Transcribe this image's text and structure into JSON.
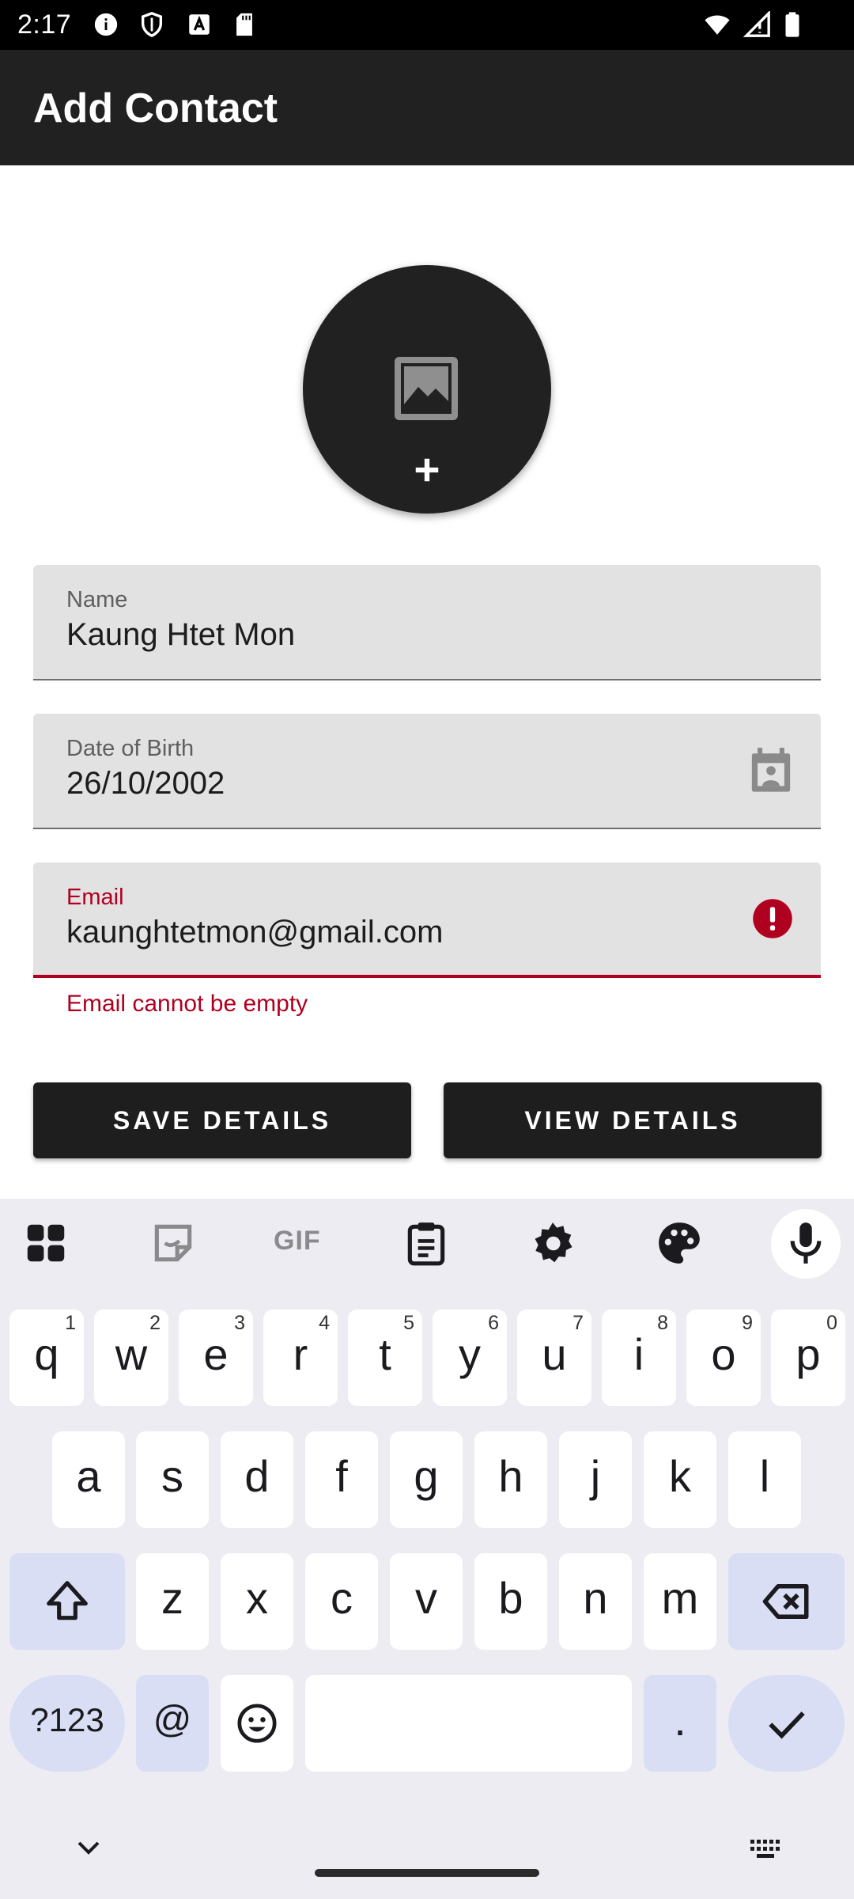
{
  "status_bar": {
    "time": "2:17",
    "icons": [
      "info-icon",
      "shield-icon",
      "a-box-icon",
      "sd-card-icon",
      "wifi-icon",
      "signal-icon",
      "battery-icon"
    ]
  },
  "app_bar": {
    "title": "Add Contact"
  },
  "avatar": {
    "icons": [
      "image-icon",
      "plus-icon"
    ]
  },
  "form": {
    "name": {
      "label": "Name",
      "value": "Kaung Htet Mon"
    },
    "dob": {
      "label": "Date of Birth",
      "value": "26/10/2002",
      "icon": "calendar-icon"
    },
    "email": {
      "label": "Email",
      "value": "kaunghtetmon@gmail.com",
      "icon": "error-icon",
      "error": "Email cannot be empty"
    }
  },
  "buttons": {
    "save": "SAVE DETAILS",
    "view": "VIEW DETAILS"
  },
  "colors": {
    "error": "#b00020",
    "app_bar": "#212121",
    "button": "#1e1e1e",
    "keyboard_bg": "#edecf2",
    "modifier_key": "#d9def5"
  },
  "keyboard": {
    "toolbar": [
      "apps-grid-icon",
      "sticker-icon",
      "gif-icon",
      "clipboard-icon",
      "settings-icon",
      "palette-icon",
      "mic-icon"
    ],
    "gif_label": "GIF",
    "row1": [
      {
        "k": "q",
        "h": "1"
      },
      {
        "k": "w",
        "h": "2"
      },
      {
        "k": "e",
        "h": "3"
      },
      {
        "k": "r",
        "h": "4"
      },
      {
        "k": "t",
        "h": "5"
      },
      {
        "k": "y",
        "h": "6"
      },
      {
        "k": "u",
        "h": "7"
      },
      {
        "k": "i",
        "h": "8"
      },
      {
        "k": "o",
        "h": "9"
      },
      {
        "k": "p",
        "h": "0"
      }
    ],
    "row2": [
      "a",
      "s",
      "d",
      "f",
      "g",
      "h",
      "j",
      "k",
      "l"
    ],
    "row3": [
      "z",
      "x",
      "c",
      "v",
      "b",
      "n",
      "m"
    ],
    "symbols": "?123",
    "at": "@",
    "period": "."
  }
}
